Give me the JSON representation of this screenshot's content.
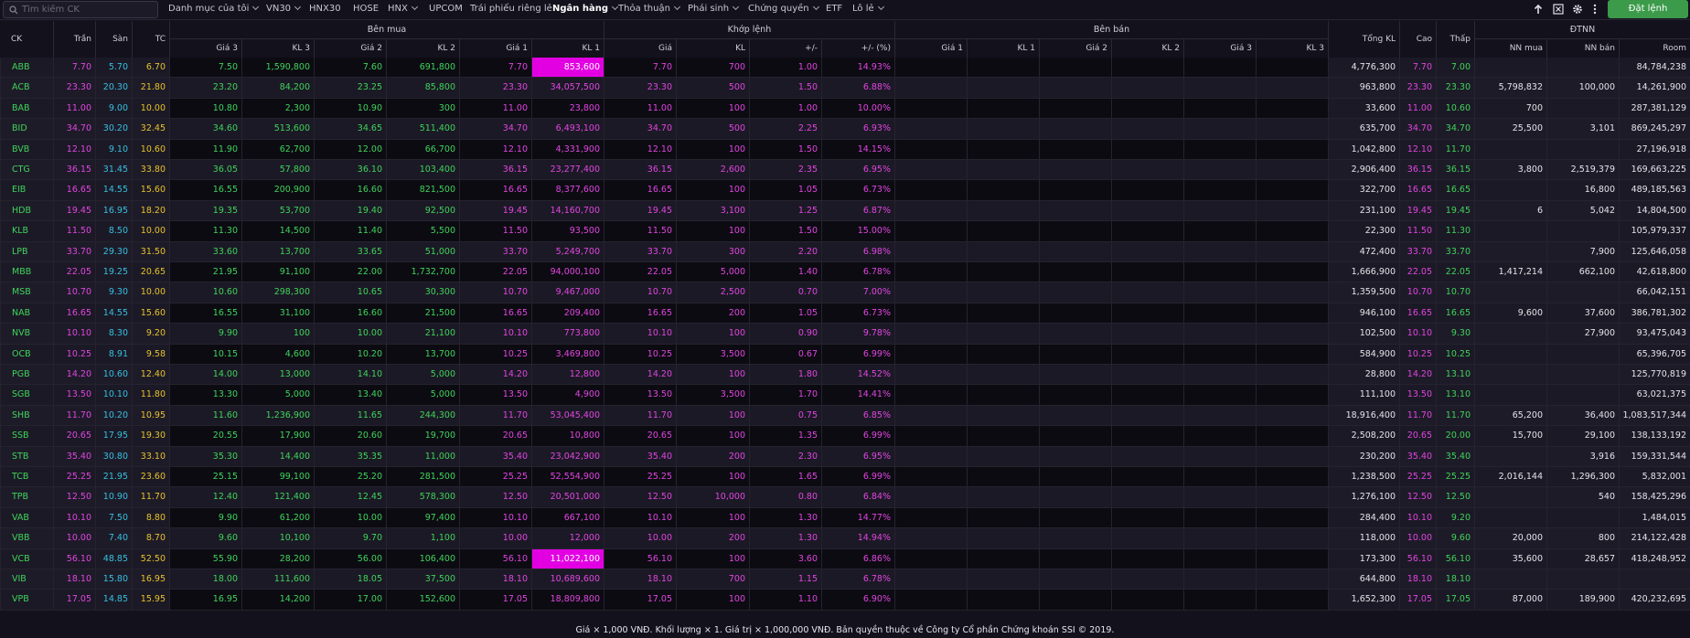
{
  "search": {
    "placeholder": "Tìm kiếm CK"
  },
  "nav": [
    {
      "label": "Danh mục của tôi",
      "dropdown": true,
      "active": false
    },
    {
      "label": "VN30",
      "dropdown": true,
      "active": false
    },
    {
      "label": "HNX30",
      "dropdown": false,
      "active": false
    },
    {
      "label": "HOSE",
      "dropdown": false,
      "active": false
    },
    {
      "label": "HNX",
      "dropdown": true,
      "active": false
    },
    {
      "label": "UPCOM",
      "dropdown": false,
      "active": false
    },
    {
      "label": "Trái phiếu riêng lẻ",
      "dropdown": false,
      "active": false
    },
    {
      "label": "Ngân hàng",
      "dropdown": true,
      "active": true
    },
    {
      "label": "Thỏa thuận",
      "dropdown": true,
      "active": false
    },
    {
      "label": "Phái sinh",
      "dropdown": true,
      "active": false
    },
    {
      "label": "Chứng quyền",
      "dropdown": true,
      "active": false
    },
    {
      "label": "ETF",
      "dropdown": false,
      "active": false
    },
    {
      "label": "Lô lẻ",
      "dropdown": true,
      "active": false
    }
  ],
  "toolbar": {
    "order_button": "Đặt lệnh",
    "icons": [
      "arrow-up-icon",
      "excel-icon",
      "settings-icon",
      "more-vertical-icon"
    ]
  },
  "colors": {
    "ceiling": "#e245e2",
    "floor": "#35c0e0",
    "reference": "#e6c32a",
    "up": "#3fd45a",
    "highlight": "#e200e2",
    "order_button": "#3c9b4a"
  },
  "header": {
    "groups": {
      "buy": "Bên mua",
      "match": "Khớp lệnh",
      "sell": "Bên bán",
      "foreign": "ĐTNN"
    },
    "cols": {
      "ck": "CK",
      "tran": "Trần",
      "san": "Sàn",
      "tc": "TC",
      "gia3": "Giá 3",
      "kl3": "KL 3",
      "gia2": "Giá 2",
      "kl2": "KL 2",
      "gia1": "Giá 1",
      "kl1": "KL 1",
      "gia": "Giá",
      "kl": "KL",
      "chg": "+/-",
      "pct": "+/- (%)",
      "tongkl": "Tổng KL",
      "cao": "Cao",
      "thap": "Thấp",
      "nnmua": "NN mua",
      "nnban": "NN bán",
      "room": "Room"
    }
  },
  "rows": [
    {
      "ck": "ABB",
      "tran": "7.70",
      "san": "5.70",
      "tc": "6.70",
      "b3": "7.50",
      "bk3": "1,590,800",
      "b2": "7.60",
      "bk2": "691,800",
      "b1": "7.70",
      "bk1": "853,600",
      "mp": "7.70",
      "mk": "700",
      "chg": "1.00",
      "pct": "14.93%",
      "tot": "4,776,300",
      "hi": "7.70",
      "lo": "7.00",
      "nnm": "",
      "nnb": "",
      "room": "84,784,238",
      "hl": true
    },
    {
      "ck": "ACB",
      "tran": "23.30",
      "san": "20.30",
      "tc": "21.80",
      "b3": "23.20",
      "bk3": "84,200",
      "b2": "23.25",
      "bk2": "85,800",
      "b1": "23.30",
      "bk1": "34,057,500",
      "mp": "23.30",
      "mk": "500",
      "chg": "1.50",
      "pct": "6.88%",
      "tot": "963,800",
      "hi": "23.30",
      "lo": "23.30",
      "nnm": "5,798,832",
      "nnb": "100,000",
      "room": "14,261,900",
      "hl": false
    },
    {
      "ck": "BAB",
      "tran": "11.00",
      "san": "9.00",
      "tc": "10.00",
      "b3": "10.80",
      "bk3": "2,300",
      "b2": "10.90",
      "bk2": "300",
      "b1": "11.00",
      "bk1": "23,800",
      "mp": "11.00",
      "mk": "100",
      "chg": "1.00",
      "pct": "10.00%",
      "tot": "33,600",
      "hi": "11.00",
      "lo": "10.60",
      "nnm": "700",
      "nnb": "",
      "room": "287,381,129",
      "hl": false
    },
    {
      "ck": "BID",
      "tran": "34.70",
      "san": "30.20",
      "tc": "32.45",
      "b3": "34.60",
      "bk3": "513,600",
      "b2": "34.65",
      "bk2": "511,400",
      "b1": "34.70",
      "bk1": "6,493,100",
      "mp": "34.70",
      "mk": "500",
      "chg": "2.25",
      "pct": "6.93%",
      "tot": "635,700",
      "hi": "34.70",
      "lo": "34.70",
      "nnm": "25,500",
      "nnb": "3,101",
      "room": "869,245,297",
      "hl": false
    },
    {
      "ck": "BVB",
      "tran": "12.10",
      "san": "9.10",
      "tc": "10.60",
      "b3": "11.90",
      "bk3": "62,700",
      "b2": "12.00",
      "bk2": "66,700",
      "b1": "12.10",
      "bk1": "4,331,900",
      "mp": "12.10",
      "mk": "100",
      "chg": "1.50",
      "pct": "14.15%",
      "tot": "1,042,800",
      "hi": "12.10",
      "lo": "11.70",
      "nnm": "",
      "nnb": "",
      "room": "27,196,918",
      "hl": false
    },
    {
      "ck": "CTG",
      "tran": "36.15",
      "san": "31.45",
      "tc": "33.80",
      "b3": "36.05",
      "bk3": "57,800",
      "b2": "36.10",
      "bk2": "103,400",
      "b1": "36.15",
      "bk1": "23,277,400",
      "mp": "36.15",
      "mk": "2,600",
      "chg": "2.35",
      "pct": "6.95%",
      "tot": "2,906,400",
      "hi": "36.15",
      "lo": "36.15",
      "nnm": "3,800",
      "nnb": "2,519,379",
      "room": "169,663,225",
      "hl": false
    },
    {
      "ck": "EIB",
      "tran": "16.65",
      "san": "14.55",
      "tc": "15.60",
      "b3": "16.55",
      "bk3": "200,900",
      "b2": "16.60",
      "bk2": "821,500",
      "b1": "16.65",
      "bk1": "8,377,600",
      "mp": "16.65",
      "mk": "100",
      "chg": "1.05",
      "pct": "6.73%",
      "tot": "322,700",
      "hi": "16.65",
      "lo": "16.65",
      "nnm": "",
      "nnb": "16,800",
      "room": "489,185,563",
      "hl": false
    },
    {
      "ck": "HDB",
      "tran": "19.45",
      "san": "16.95",
      "tc": "18.20",
      "b3": "19.35",
      "bk3": "53,700",
      "b2": "19.40",
      "bk2": "92,500",
      "b1": "19.45",
      "bk1": "14,160,700",
      "mp": "19.45",
      "mk": "3,100",
      "chg": "1.25",
      "pct": "6.87%",
      "tot": "231,100",
      "hi": "19.45",
      "lo": "19.45",
      "nnm": "6",
      "nnb": "5,042",
      "room": "14,804,500",
      "hl": false
    },
    {
      "ck": "KLB",
      "tran": "11.50",
      "san": "8.50",
      "tc": "10.00",
      "b3": "11.30",
      "bk3": "14,500",
      "b2": "11.40",
      "bk2": "5,500",
      "b1": "11.50",
      "bk1": "93,500",
      "mp": "11.50",
      "mk": "100",
      "chg": "1.50",
      "pct": "15.00%",
      "tot": "22,300",
      "hi": "11.50",
      "lo": "11.30",
      "nnm": "",
      "nnb": "",
      "room": "105,979,337",
      "hl": false
    },
    {
      "ck": "LPB",
      "tran": "33.70",
      "san": "29.30",
      "tc": "31.50",
      "b3": "33.60",
      "bk3": "13,700",
      "b2": "33.65",
      "bk2": "51,000",
      "b1": "33.70",
      "bk1": "5,249,700",
      "mp": "33.70",
      "mk": "300",
      "chg": "2.20",
      "pct": "6.98%",
      "tot": "472,400",
      "hi": "33.70",
      "lo": "33.70",
      "nnm": "",
      "nnb": "7,900",
      "room": "125,646,058",
      "hl": false
    },
    {
      "ck": "MBB",
      "tran": "22.05",
      "san": "19.25",
      "tc": "20.65",
      "b3": "21.95",
      "bk3": "91,100",
      "b2": "22.00",
      "bk2": "1,732,700",
      "b1": "22.05",
      "bk1": "94,000,100",
      "mp": "22.05",
      "mk": "5,000",
      "chg": "1.40",
      "pct": "6.78%",
      "tot": "1,666,900",
      "hi": "22.05",
      "lo": "22.05",
      "nnm": "1,417,214",
      "nnb": "662,100",
      "room": "42,618,800",
      "hl": false
    },
    {
      "ck": "MSB",
      "tran": "10.70",
      "san": "9.30",
      "tc": "10.00",
      "b3": "10.60",
      "bk3": "298,300",
      "b2": "10.65",
      "bk2": "30,300",
      "b1": "10.70",
      "bk1": "9,467,000",
      "mp": "10.70",
      "mk": "2,500",
      "chg": "0.70",
      "pct": "7.00%",
      "tot": "1,359,500",
      "hi": "10.70",
      "lo": "10.70",
      "nnm": "",
      "nnb": "",
      "room": "66,042,151",
      "hl": false
    },
    {
      "ck": "NAB",
      "tran": "16.65",
      "san": "14.55",
      "tc": "15.60",
      "b3": "16.55",
      "bk3": "31,100",
      "b2": "16.60",
      "bk2": "21,500",
      "b1": "16.65",
      "bk1": "209,400",
      "mp": "16.65",
      "mk": "200",
      "chg": "1.05",
      "pct": "6.73%",
      "tot": "946,100",
      "hi": "16.65",
      "lo": "16.65",
      "nnm": "9,600",
      "nnb": "37,600",
      "room": "386,781,302",
      "hl": false
    },
    {
      "ck": "NVB",
      "tran": "10.10",
      "san": "8.30",
      "tc": "9.20",
      "b3": "9.90",
      "bk3": "100",
      "b2": "10.00",
      "bk2": "21,100",
      "b1": "10.10",
      "bk1": "773,800",
      "mp": "10.10",
      "mk": "100",
      "chg": "0.90",
      "pct": "9.78%",
      "tot": "102,500",
      "hi": "10.10",
      "lo": "9.30",
      "nnm": "",
      "nnb": "27,900",
      "room": "93,475,043",
      "hl": false
    },
    {
      "ck": "OCB",
      "tran": "10.25",
      "san": "8.91",
      "tc": "9.58",
      "b3": "10.15",
      "bk3": "4,600",
      "b2": "10.20",
      "bk2": "13,700",
      "b1": "10.25",
      "bk1": "3,469,800",
      "mp": "10.25",
      "mk": "3,500",
      "chg": "0.67",
      "pct": "6.99%",
      "tot": "584,900",
      "hi": "10.25",
      "lo": "10.25",
      "nnm": "",
      "nnb": "",
      "room": "65,396,705",
      "hl": false
    },
    {
      "ck": "PGB",
      "tran": "14.20",
      "san": "10.60",
      "tc": "12.40",
      "b3": "14.00",
      "bk3": "13,000",
      "b2": "14.10",
      "bk2": "5,000",
      "b1": "14.20",
      "bk1": "12,800",
      "mp": "14.20",
      "mk": "100",
      "chg": "1.80",
      "pct": "14.52%",
      "tot": "28,800",
      "hi": "14.20",
      "lo": "13.10",
      "nnm": "",
      "nnb": "",
      "room": "125,770,819",
      "hl": false
    },
    {
      "ck": "SGB",
      "tran": "13.50",
      "san": "10.10",
      "tc": "11.80",
      "b3": "13.30",
      "bk3": "5,000",
      "b2": "13.40",
      "bk2": "5,000",
      "b1": "13.50",
      "bk1": "4,900",
      "mp": "13.50",
      "mk": "3,500",
      "chg": "1.70",
      "pct": "14.41%",
      "tot": "111,100",
      "hi": "13.50",
      "lo": "13.10",
      "nnm": "",
      "nnb": "",
      "room": "63,021,375",
      "hl": false
    },
    {
      "ck": "SHB",
      "tran": "11.70",
      "san": "10.20",
      "tc": "10.95",
      "b3": "11.60",
      "bk3": "1,236,900",
      "b2": "11.65",
      "bk2": "244,300",
      "b1": "11.70",
      "bk1": "53,045,400",
      "mp": "11.70",
      "mk": "100",
      "chg": "0.75",
      "pct": "6.85%",
      "tot": "18,916,400",
      "hi": "11.70",
      "lo": "11.70",
      "nnm": "65,200",
      "nnb": "36,400",
      "room": "1,083,517,344",
      "hl": false
    },
    {
      "ck": "SSB",
      "tran": "20.65",
      "san": "17.95",
      "tc": "19.30",
      "b3": "20.55",
      "bk3": "17,900",
      "b2": "20.60",
      "bk2": "19,700",
      "b1": "20.65",
      "bk1": "10,800",
      "mp": "20.65",
      "mk": "100",
      "chg": "1.35",
      "pct": "6.99%",
      "tot": "2,508,200",
      "hi": "20.65",
      "lo": "20.00",
      "nnm": "15,700",
      "nnb": "29,100",
      "room": "138,133,192",
      "hl": false
    },
    {
      "ck": "STB",
      "tran": "35.40",
      "san": "30.80",
      "tc": "33.10",
      "b3": "35.30",
      "bk3": "14,400",
      "b2": "35.35",
      "bk2": "11,000",
      "b1": "35.40",
      "bk1": "23,042,900",
      "mp": "35.40",
      "mk": "200",
      "chg": "2.30",
      "pct": "6.95%",
      "tot": "230,200",
      "hi": "35.40",
      "lo": "35.40",
      "nnm": "",
      "nnb": "3,916",
      "room": "159,331,544",
      "hl": false
    },
    {
      "ck": "TCB",
      "tran": "25.25",
      "san": "21.95",
      "tc": "23.60",
      "b3": "25.15",
      "bk3": "99,100",
      "b2": "25.20",
      "bk2": "281,500",
      "b1": "25.25",
      "bk1": "52,554,900",
      "mp": "25.25",
      "mk": "100",
      "chg": "1.65",
      "pct": "6.99%",
      "tot": "1,238,500",
      "hi": "25.25",
      "lo": "25.25",
      "nnm": "2,016,144",
      "nnb": "1,296,300",
      "room": "5,832,001",
      "hl": false
    },
    {
      "ck": "TPB",
      "tran": "12.50",
      "san": "10.90",
      "tc": "11.70",
      "b3": "12.40",
      "bk3": "121,400",
      "b2": "12.45",
      "bk2": "578,300",
      "b1": "12.50",
      "bk1": "20,501,000",
      "mp": "12.50",
      "mk": "10,000",
      "chg": "0.80",
      "pct": "6.84%",
      "tot": "1,276,100",
      "hi": "12.50",
      "lo": "12.50",
      "nnm": "",
      "nnb": "540",
      "room": "158,425,296",
      "hl": false
    },
    {
      "ck": "VAB",
      "tran": "10.10",
      "san": "7.50",
      "tc": "8.80",
      "b3": "9.90",
      "bk3": "61,200",
      "b2": "10.00",
      "bk2": "97,400",
      "b1": "10.10",
      "bk1": "667,100",
      "mp": "10.10",
      "mk": "100",
      "chg": "1.30",
      "pct": "14.77%",
      "tot": "284,400",
      "hi": "10.10",
      "lo": "9.20",
      "nnm": "",
      "nnb": "",
      "room": "1,484,015",
      "hl": false
    },
    {
      "ck": "VBB",
      "tran": "10.00",
      "san": "7.40",
      "tc": "8.70",
      "b3": "9.60",
      "bk3": "10,100",
      "b2": "9.70",
      "bk2": "1,100",
      "b1": "10.00",
      "bk1": "12,000",
      "mp": "10.00",
      "mk": "200",
      "chg": "1.30",
      "pct": "14.94%",
      "tot": "118,000",
      "hi": "10.00",
      "lo": "9.60",
      "nnm": "20,000",
      "nnb": "800",
      "room": "214,122,428",
      "hl": false
    },
    {
      "ck": "VCB",
      "tran": "56.10",
      "san": "48.85",
      "tc": "52.50",
      "b3": "55.90",
      "bk3": "28,200",
      "b2": "56.00",
      "bk2": "106,400",
      "b1": "56.10",
      "bk1": "11,022,100",
      "mp": "56.10",
      "mk": "100",
      "chg": "3.60",
      "pct": "6.86%",
      "tot": "173,300",
      "hi": "56.10",
      "lo": "56.10",
      "nnm": "35,600",
      "nnb": "28,657",
      "room": "418,248,952",
      "hl": true
    },
    {
      "ck": "VIB",
      "tran": "18.10",
      "san": "15.80",
      "tc": "16.95",
      "b3": "18.00",
      "bk3": "111,600",
      "b2": "18.05",
      "bk2": "37,500",
      "b1": "18.10",
      "bk1": "10,689,600",
      "mp": "18.10",
      "mk": "700",
      "chg": "1.15",
      "pct": "6.78%",
      "tot": "644,800",
      "hi": "18.10",
      "lo": "18.10",
      "nnm": "",
      "nnb": "",
      "room": "",
      "hl": false
    },
    {
      "ck": "VPB",
      "tran": "17.05",
      "san": "14.85",
      "tc": "15.95",
      "b3": "16.95",
      "bk3": "14,200",
      "b2": "17.00",
      "bk2": "152,600",
      "b1": "17.05",
      "bk1": "18,809,800",
      "mp": "17.05",
      "mk": "100",
      "chg": "1.10",
      "pct": "6.90%",
      "tot": "1,652,300",
      "hi": "17.05",
      "lo": "17.05",
      "nnm": "87,000",
      "nnb": "189,900",
      "room": "420,232,695",
      "hl": false
    }
  ],
  "footer": "Giá × 1,000 VNĐ. Khối lượng × 1. Giá trị × 1,000,000 VNĐ. Bản quyền thuộc về Công ty Cổ phần Chứng khoán SSI © 2019."
}
